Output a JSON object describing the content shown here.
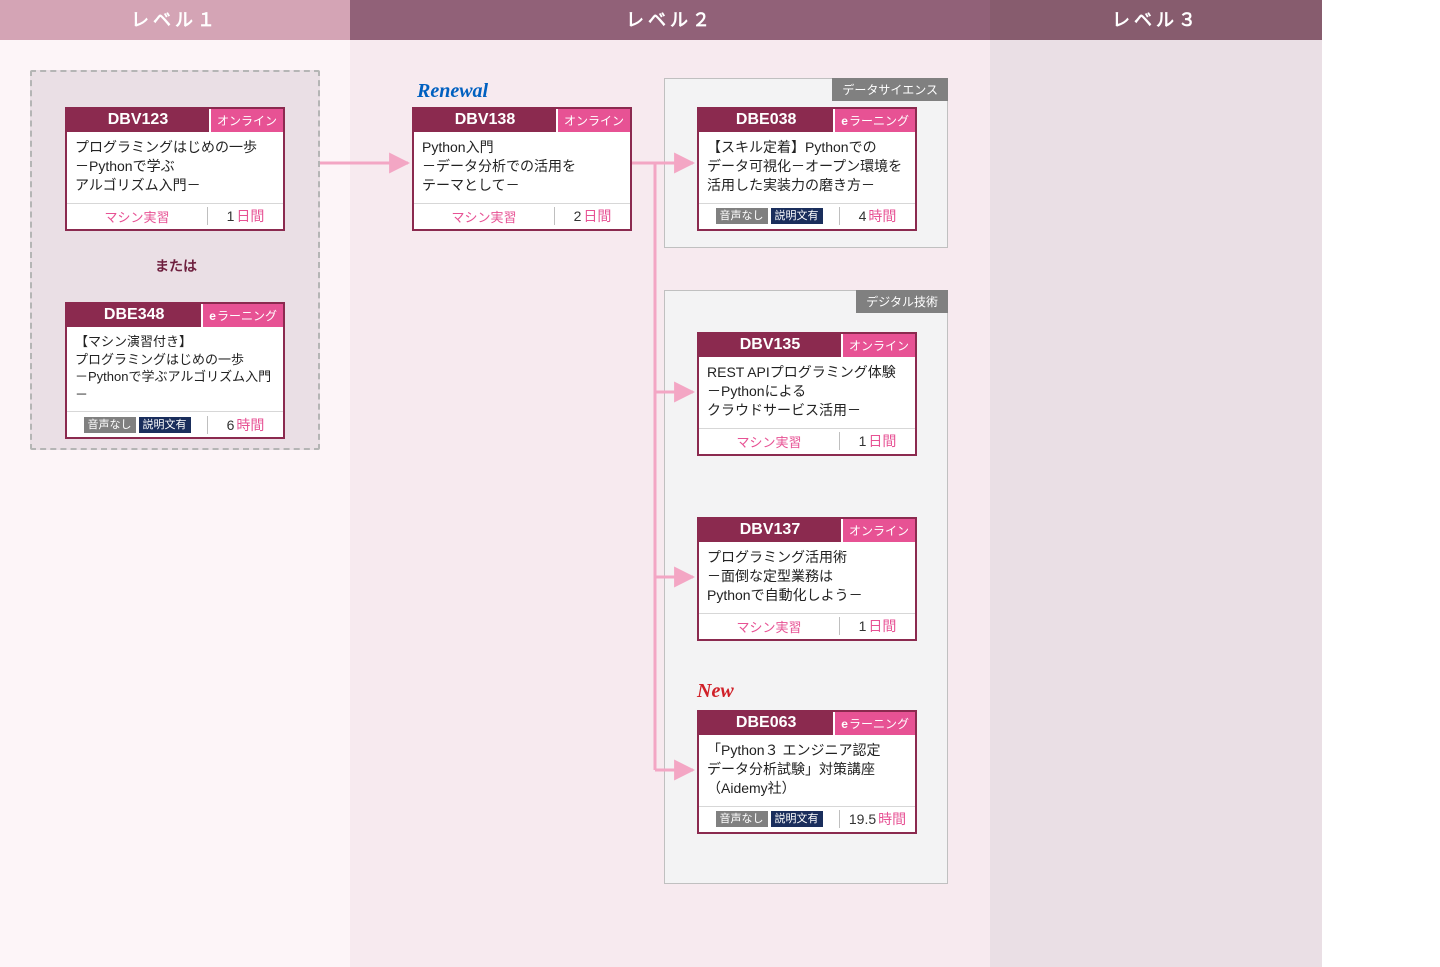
{
  "levels": {
    "l1": "レベル１",
    "l2": "レベル２",
    "l3": "レベル３"
  },
  "or_label": "または",
  "flags": {
    "renewal": "Renewal",
    "new": "New"
  },
  "categories": {
    "data_science": "データサイエンス",
    "digital_tech": "デジタル技術"
  },
  "foot": {
    "machine": "マシン実習",
    "audio_none": "音声なし",
    "desc_yes": "説明文有",
    "day_unit": "日間",
    "hour_unit": "時間"
  },
  "modes": {
    "online": "オンライン",
    "elearning_prefix": "e",
    "elearning_suffix": "ラーニング"
  },
  "cards": {
    "dbv123": {
      "code": "DBV123",
      "mode": "online",
      "title": "プログラミングはじめの一歩\n－Pythonで学ぶ\nアルゴリズム入門－",
      "duration_num": "1",
      "duration_unit": "day",
      "foot_style": "machine"
    },
    "dbe348": {
      "code": "DBE348",
      "mode": "elearning",
      "title": "【マシン演習付き】\nプログラミングはじめの一歩\n－Pythonで学ぶアルゴリズム入門－",
      "duration_num": "6",
      "duration_unit": "hour",
      "foot_style": "pills"
    },
    "dbv138": {
      "code": "DBV138",
      "mode": "online",
      "title": "Python入門\n－データ分析での活用を\nテーマとして－",
      "duration_num": "2",
      "duration_unit": "day",
      "foot_style": "machine"
    },
    "dbe038": {
      "code": "DBE038",
      "mode": "elearning",
      "title": "【スキル定着】Pythonでの\nデータ可視化－オープン環境を\n活用した実装力の磨き方－",
      "duration_num": "4",
      "duration_unit": "hour",
      "foot_style": "pills"
    },
    "dbv135": {
      "code": "DBV135",
      "mode": "online",
      "title": "REST APIプログラミング体験\n－Pythonによる\nクラウドサービス活用－",
      "duration_num": "1",
      "duration_unit": "day",
      "foot_style": "machine"
    },
    "dbv137": {
      "code": "DBV137",
      "mode": "online",
      "title": "プログラミング活用術\n－面倒な定型業務は\nPythonで自動化しよう－",
      "duration_num": "1",
      "duration_unit": "day",
      "foot_style": "machine"
    },
    "dbe063": {
      "code": "DBE063",
      "mode": "elearning",
      "title": "「Python３ エンジニア認定\nデータ分析試験」対策講座\n（Aidemy社）",
      "duration_num": "19.5",
      "duration_unit": "hour",
      "foot_style": "pills"
    }
  }
}
